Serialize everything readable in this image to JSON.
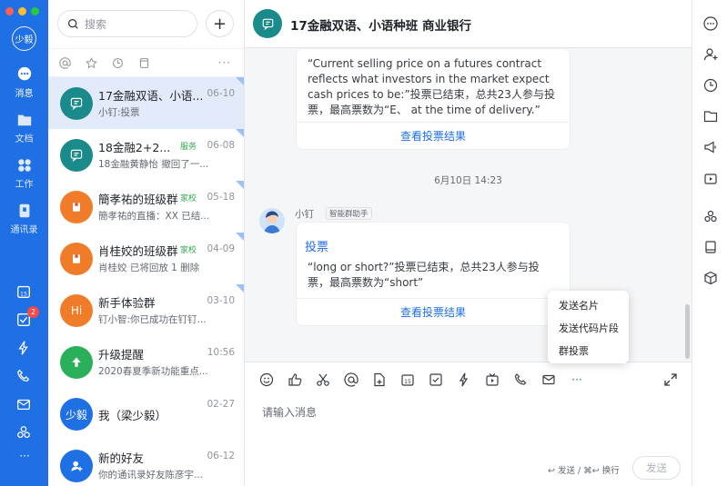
{
  "user": {
    "avatar_text": "少毅"
  },
  "nav": {
    "items": [
      {
        "label": "消息"
      },
      {
        "label": "文档"
      },
      {
        "label": "工作"
      },
      {
        "label": "通讯录"
      }
    ],
    "todo_badge": "2",
    "more": "···"
  },
  "search": {
    "placeholder": "搜索"
  },
  "list_more": "···",
  "conversations": [
    {
      "name": "17金融双语、小语...",
      "time": "06-10",
      "preview": "小钉:投票",
      "avatar_color": "#1a8a8a",
      "avatar_text": ""
    },
    {
      "name": "18金融2+2...",
      "tag": "服务",
      "time": "06-08",
      "preview": "18金融黄静怡 撤回了一...",
      "avatar_color": "#1a8a8a",
      "avatar_text": ""
    },
    {
      "name": "簡孝祐的班级群",
      "tag": "家校",
      "time": "05-18",
      "preview": "簡孝祐的直播：XX 已结...",
      "avatar_color": "#f07c2a",
      "avatar_text": ""
    },
    {
      "name": "肖桂姣的班级群",
      "tag": "家校",
      "time": "04-09",
      "preview": "肖桂姣 已将回放 1 删除",
      "avatar_color": "#f07c2a",
      "avatar_text": ""
    },
    {
      "name": "新手体验群",
      "time": "03-10",
      "preview": "钉小智:你已成功在钉钉...",
      "avatar_color": "#f07c2a",
      "avatar_text": "Hi"
    },
    {
      "name": "升级提醒",
      "time": "10:56",
      "preview": "2020春夏季新功能重点...",
      "avatar_color": "#2ab05a",
      "avatar_text": ""
    },
    {
      "name": "我（梁少毅）",
      "time": "02-27",
      "preview": "",
      "avatar_color": "#1f6fe5",
      "avatar_text": "少毅"
    },
    {
      "name": "新的好友",
      "time": "06-12",
      "preview": "你的通讯录好友陈彦宇...",
      "avatar_color": "#1f6fe5",
      "avatar_text": ""
    }
  ],
  "chat": {
    "title": "17金融双语、小语种班 商业银行",
    "msg1": {
      "text": "“Current selling price on a futures contract reflects what investors in the market expect cash prices to be:”投票已结束，总共23人参与投票，最高票数为“E、 at the time of delivery.”",
      "link": "查看投票结果"
    },
    "timestamp": "6月10日 14:23",
    "sender": "小钉",
    "sender_tag": "智能群助手",
    "msg2": {
      "title": "投票",
      "text": "“long or short?”投票已结束，总共23人参与投票，最高票数为“short”",
      "link": "查看投票结果"
    },
    "more_label": "···",
    "input_placeholder": "请输入消息",
    "hint": "↩ 发送 / ⌘↩ 换行",
    "send_label": "发送"
  },
  "popup": {
    "items": [
      "发送名片",
      "发送代码片段",
      "群投票"
    ]
  }
}
